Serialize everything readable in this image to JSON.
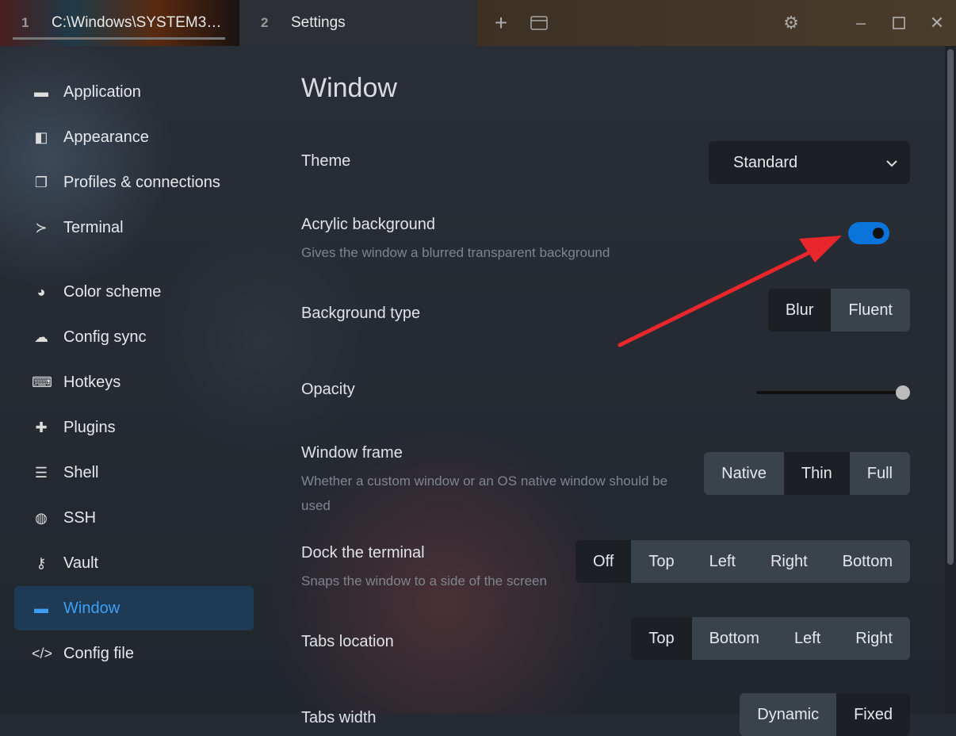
{
  "tabs": [
    {
      "num": "1",
      "label": "C:\\Windows\\SYSTEM3…"
    },
    {
      "num": "2",
      "label": "Settings"
    }
  ],
  "titlebar_icons": [
    "plus-icon",
    "window-icon",
    "gear-icon",
    "minimize-icon",
    "maximize-icon",
    "close-icon"
  ],
  "sidebar": {
    "active": "Window",
    "items": [
      {
        "label": "Application",
        "icon": "window-icon"
      },
      {
        "label": "Appearance",
        "icon": "palette-swatch-icon"
      },
      {
        "label": "Profiles & connections",
        "icon": "profiles-icon"
      },
      {
        "label": "Terminal",
        "icon": "terminal-icon"
      },
      {
        "label": "Color scheme",
        "icon": "palette-icon"
      },
      {
        "label": "Config sync",
        "icon": "cloud-icon"
      },
      {
        "label": "Hotkeys",
        "icon": "keyboard-icon"
      },
      {
        "label": "Plugins",
        "icon": "puzzle-icon"
      },
      {
        "label": "Shell",
        "icon": "list-icon"
      },
      {
        "label": "SSH",
        "icon": "globe-icon"
      },
      {
        "label": "Vault",
        "icon": "key-icon"
      },
      {
        "label": "Window",
        "icon": "window-icon"
      },
      {
        "label": "Config file",
        "icon": "code-icon"
      }
    ]
  },
  "main": {
    "title": "Window",
    "theme": {
      "label": "Theme",
      "value": "Standard"
    },
    "acrylic": {
      "label": "Acrylic background",
      "desc": "Gives the window a blurred transparent background",
      "enabled": true
    },
    "bgtype": {
      "label": "Background type",
      "options": [
        "Blur",
        "Fluent"
      ],
      "selected": "Blur"
    },
    "opacity": {
      "label": "Opacity",
      "value": 1.0
    },
    "frame": {
      "label": "Window frame",
      "desc": "Whether a custom window or an OS native window should be used",
      "options": [
        "Native",
        "Thin",
        "Full"
      ],
      "selected": "Thin"
    },
    "dock": {
      "label": "Dock the terminal",
      "desc": "Snaps the window to a side of the screen",
      "options": [
        "Off",
        "Top",
        "Left",
        "Right",
        "Bottom"
      ],
      "selected": "Off"
    },
    "tabsloc": {
      "label": "Tabs location",
      "options": [
        "Top",
        "Bottom",
        "Left",
        "Right"
      ],
      "selected": "Top"
    },
    "tabswidth": {
      "label": "Tabs width",
      "options": [
        "Dynamic",
        "Fixed"
      ],
      "selected": "Fixed"
    }
  },
  "colors": {
    "accent": "#0a74da",
    "arrow": "#e8262b",
    "active_item": "#3ea0f5"
  }
}
